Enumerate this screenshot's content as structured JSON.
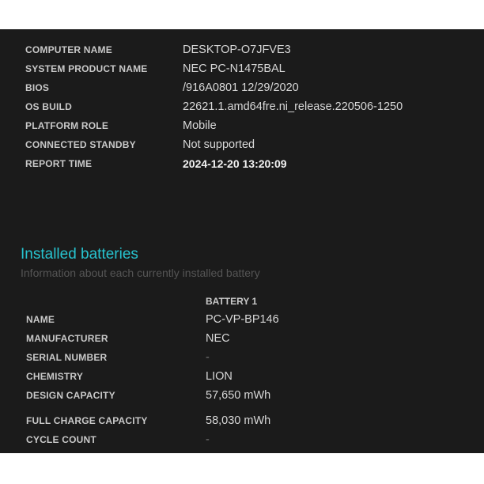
{
  "system": [
    {
      "label": "COMPUTER NAME",
      "value": "DESKTOP-O7JFVE3"
    },
    {
      "label": "SYSTEM PRODUCT NAME",
      "value": "NEC PC-N1475BAL"
    },
    {
      "label": "BIOS",
      "value": "/916A0801 12/29/2020"
    },
    {
      "label": "OS BUILD",
      "value": "22621.1.amd64fre.ni_release.220506-1250"
    },
    {
      "label": "PLATFORM ROLE",
      "value": "Mobile"
    },
    {
      "label": "CONNECTED STANDBY",
      "value": "Not supported"
    },
    {
      "label": "REPORT TIME",
      "value": "2024-12-20  13:20:09"
    }
  ],
  "batteries": {
    "title": "Installed batteries",
    "subtitle": "Information about each currently installed battery",
    "column": "BATTERY 1",
    "rows": [
      {
        "label": "NAME",
        "value": "PC-VP-BP146"
      },
      {
        "label": "MANUFACTURER",
        "value": "NEC"
      },
      {
        "label": "SERIAL NUMBER",
        "value": "-"
      },
      {
        "label": "CHEMISTRY",
        "value": "LION"
      },
      {
        "label": "DESIGN CAPACITY",
        "value": "57,650 mWh"
      },
      {
        "label": "FULL CHARGE CAPACITY",
        "value": "58,030 mWh"
      },
      {
        "label": "CYCLE COUNT",
        "value": "-"
      }
    ]
  }
}
